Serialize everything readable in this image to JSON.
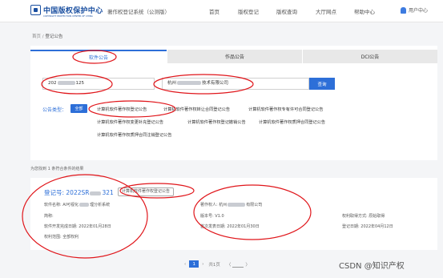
{
  "header": {
    "logo_text": "中国版权保护中心",
    "logo_sub": "COPYRIGHT PROTECTION CENTER OF CHINA",
    "system_name": "著作权登记系统（公测版）",
    "nav": [
      "首页",
      "版权登记",
      "版权查询",
      "大厅网点",
      "帮助中心"
    ],
    "user_label": "用户中心"
  },
  "breadcrumb": {
    "home": "首页",
    "sep": " / ",
    "current": "登记公告"
  },
  "tabs": [
    "软件公告",
    "作品公告",
    "DCI公告"
  ],
  "search": {
    "reg_no_value": "202",
    "reg_no_suffix": "125",
    "owner_value": "杭州",
    "owner_suffix": "技术有限公司",
    "button": "查询"
  },
  "filter": {
    "title": "公告类型：",
    "all": "全部",
    "options": [
      "计算机软件著作权登记公告",
      "计算机软件著作权转让合同登记公告",
      "计算机软件著作权专有许可合同登记公告",
      "计算机软件著作权变更补充登记公告",
      "计算机软件著作权登记撤销公告",
      "计算机软件著作权质押合同登记公告",
      "计算机软件著作权质押合同注销登记公告"
    ]
  },
  "result_count": "为您找到 1 条符合条件的结果",
  "result": {
    "reg_no": "登记号: 2022SR",
    "reg_no_suffix": "321",
    "tag": "计算机软件著作权登记公告",
    "software_name": "软件名称: AI可视化",
    "software_name_suffix": "理分析系统",
    "short_name": "简称:",
    "owner": "著作权人: 杭州",
    "owner_suffix": "有限公司",
    "version": "版本号: V1.0",
    "acquire_method": "权利取得方式: 原始取得",
    "dev_date": "软件开发完成日期: 2022年01月28日",
    "publish_date": "首次发表日期: 2022年01月30日",
    "reg_date": "登记日期: 2022年04月12日",
    "scope": "权利范围: 全部权利"
  },
  "pagination": {
    "current": "1",
    "total": "共1页",
    "goto_prefix": "〈",
    "goto_suffix": "〉"
  },
  "watermark": "CSDN @知识产权",
  "colors": {
    "accent": "#2d6fd8",
    "annotation": "#e0161b"
  }
}
